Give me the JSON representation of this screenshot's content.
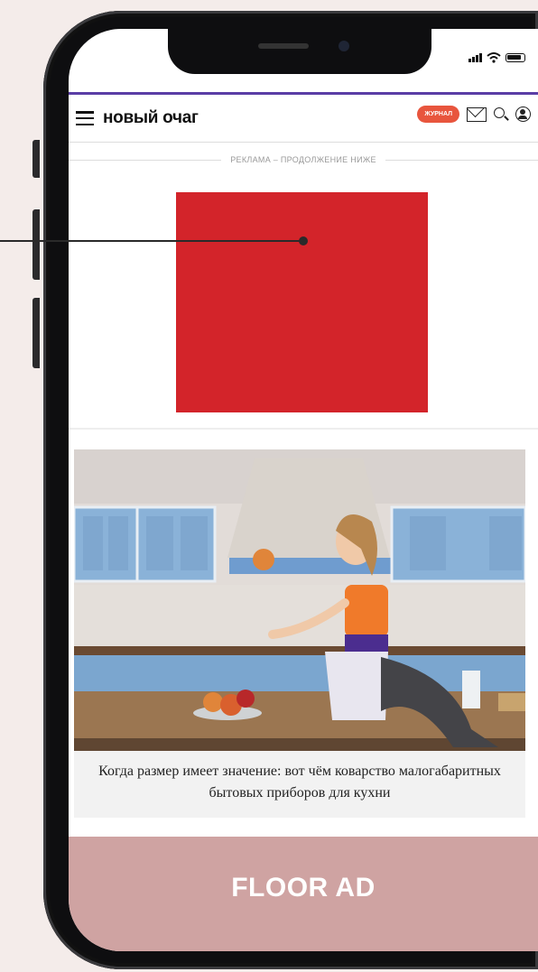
{
  "header": {
    "logo": "новый очаг",
    "magazine_badge": "ЖУРНАЛ"
  },
  "ad": {
    "label": "РЕКЛАМА – ПРОДОЛЖЕНИЕ НИЖЕ",
    "color": "#d3242a"
  },
  "article": {
    "caption": "Когда размер имеет значение: вот чём коварство малогабаритных бытовых приборов для кухни"
  },
  "floor_ad": {
    "label": "FLOOR AD",
    "color": "#cfa3a2"
  },
  "colors": {
    "accent_bar": "#5a3ea6",
    "badge": "#e8553d",
    "background": "#f4ecea"
  },
  "icons": [
    "menu-icon",
    "mail-icon",
    "search-icon",
    "user-icon",
    "signal-icon",
    "wifi-icon",
    "battery-icon"
  ]
}
